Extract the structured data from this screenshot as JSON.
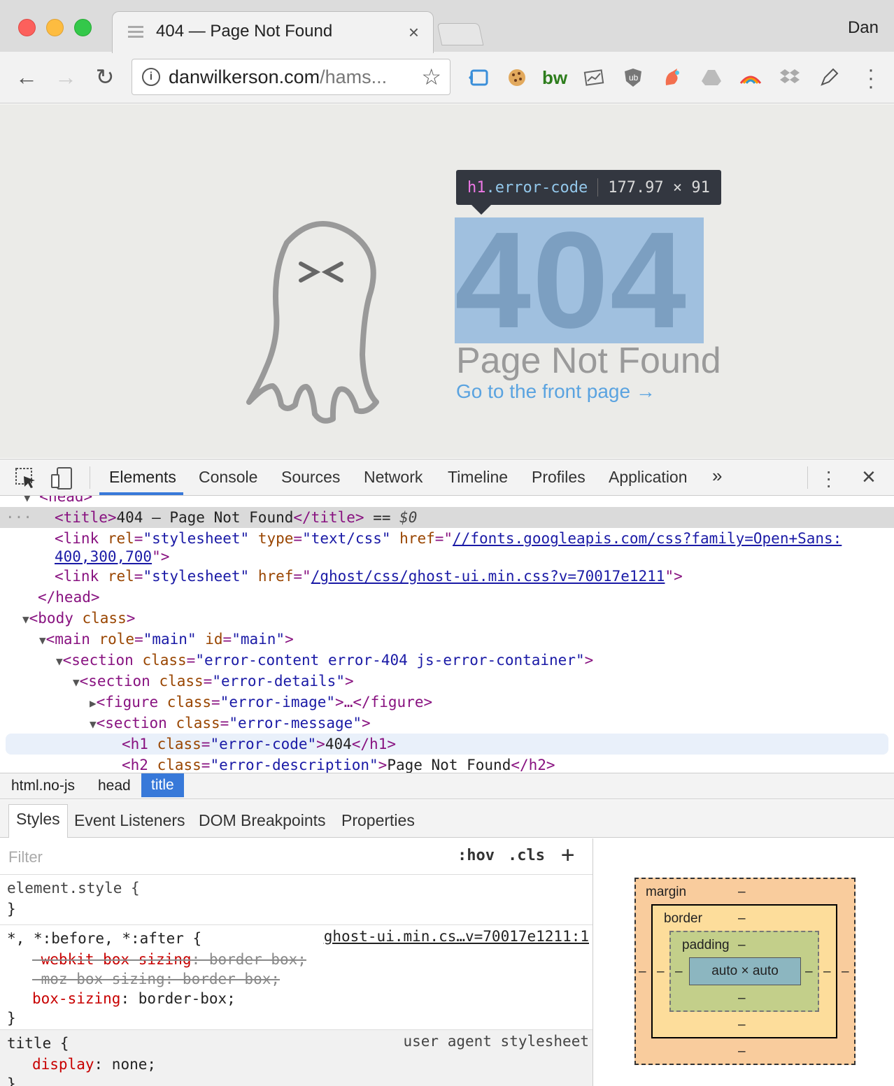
{
  "browser": {
    "tab_title": "404 — Page Not Found",
    "tab_close": "×",
    "user_name": "Dan",
    "url_host": "danwilkerson.com",
    "url_path": "/hams...",
    "extensions": [
      "tag-icon",
      "cookie-icon",
      "bw-icon",
      "chart-icon",
      "ublock-icon",
      "unicorn-icon",
      "drive-icon",
      "rainbow-icon",
      "dropbox-icon",
      "pen-icon"
    ],
    "ext_bw_text": "bw"
  },
  "page": {
    "error_code": "404",
    "error_description": "Page Not Found",
    "error_link": "Go to the front page →",
    "tooltip": {
      "tag": "h1",
      "class": ".error-code",
      "size": "177.97 × 91"
    }
  },
  "devtools": {
    "tabs": [
      "Elements",
      "Console",
      "Sources",
      "Network",
      "Timeline",
      "Profiles",
      "Application"
    ],
    "more": "»",
    "dom": {
      "l0_tag": "<head>",
      "l1_open": "<title>",
      "l1_text": "404 – Page Not Found",
      "l1_close": "</title>",
      "l1_eq": " == ",
      "l1_var": "$0",
      "l2_tag": "<link ",
      "l2_a1": "rel",
      "l2_v1": "\"stylesheet\"",
      "l2_a2": "type",
      "l2_v2": "\"text/css\"",
      "l2_a3": "href",
      "l2_v3": "//fonts.googleapis.com/css?family=Open+Sans:",
      "l2b_v3": "400,300,700",
      "l3_v3": "/ghost/css/ghost-ui.min.css?v=70017e1211",
      "l4": "</head>",
      "l5_tag": "<body ",
      "l5_a": "class",
      "l6_tag": "<main ",
      "l6_a1": "role",
      "l6_v1": "\"main\"",
      "l6_a2": "id",
      "l6_v2": "\"main\"",
      "l7_tag": "<section ",
      "l7_a": "class",
      "l7_v": "\"error-content error-404 js-error-container\"",
      "l8_v": "\"error-details\"",
      "l9_tag": "<figure ",
      "l9_v": "\"error-image\"",
      "l9_end": "…</figure>",
      "l10_v": "\"error-message\"",
      "l11_tag": "<h1 ",
      "l11_v": "\"error-code\"",
      "l11_text": "404",
      "l11_close": "</h1>",
      "l12_tag": "<h2 ",
      "l12_v": "\"error-description\"",
      "l12_text": "Page Not Found",
      "l12_close": "</h2>"
    },
    "breadcrumbs": [
      "html.no-js",
      "head",
      "title"
    ],
    "sub_tabs": [
      "Styles",
      "Event Listeners",
      "DOM Breakpoints",
      "Properties"
    ],
    "styles": {
      "filter_placeholder": "Filter",
      "hov": ":hov",
      "cls": ".cls",
      "plus": "+",
      "r1_sel": "element.style {",
      "r1_close": "}",
      "r2_sel": "*, *:before, *:after {",
      "r2_src": "ghost-ui.min.cs…v=70017e1211:1",
      "r2_p1": "-webkit-box-sizing",
      "r2_v1": ": border-box;",
      "r2_p2": "-moz-box-sizing: border-box;",
      "r2_p3": "box-sizing",
      "r2_v3": ": border-box;",
      "r2_close": "}",
      "r3_sel": "title {",
      "r3_src": "user agent stylesheet",
      "r3_p": "display",
      "r3_v": ": none;",
      "r3_close": "}"
    },
    "box_model": {
      "margin": "margin",
      "border": "border",
      "padding": "padding",
      "content": "auto × auto",
      "dash": "–"
    }
  },
  "colors": {
    "highlight": "#a0c0df",
    "accent": "#3879d9"
  }
}
